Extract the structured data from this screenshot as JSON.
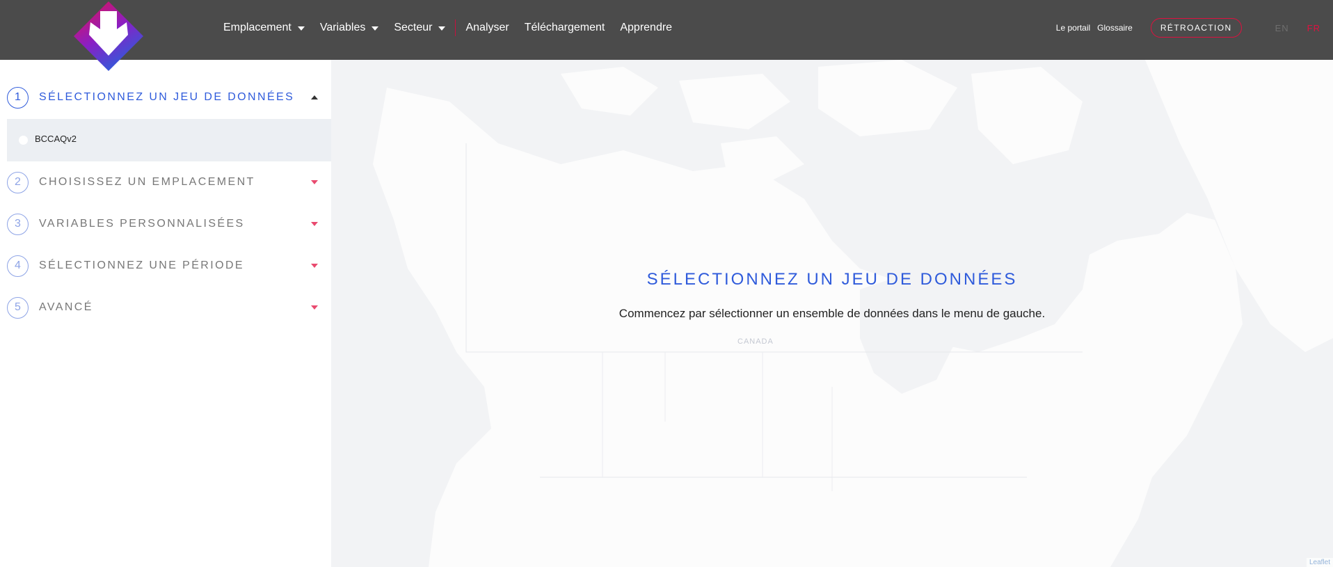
{
  "header": {
    "nav": [
      {
        "label": "Emplacement",
        "dropdown": true
      },
      {
        "label": "Variables",
        "dropdown": true
      },
      {
        "label": "Secteur",
        "dropdown": true
      },
      {
        "label": "Analyser",
        "dropdown": false
      },
      {
        "label": "Téléchargement",
        "dropdown": false
      },
      {
        "label": "Apprendre",
        "dropdown": false
      }
    ],
    "portal_label": "Le portail",
    "glossary_label": "Glossaire",
    "feedback_label": "RÉTROACTION",
    "lang_en": "EN",
    "lang_fr": "FR",
    "colors": {
      "header_bg": "#4b4b4b",
      "accent_red": "#e0103f",
      "accent_blue": "#2f5bdb"
    }
  },
  "sidebar": {
    "steps": [
      {
        "num": "1",
        "label": "SÉLECTIONNEZ UN JEU DE DONNÉES",
        "expanded": true
      },
      {
        "num": "2",
        "label": "CHOISISSEZ UN EMPLACEMENT",
        "expanded": false
      },
      {
        "num": "3",
        "label": "VARIABLES PERSONNALISÉES",
        "expanded": false
      },
      {
        "num": "4",
        "label": "SÉLECTIONNEZ UNE PÉRIODE",
        "expanded": false
      },
      {
        "num": "5",
        "label": "AVANCÉ",
        "expanded": false
      }
    ],
    "dataset_option": "BCCAQv2"
  },
  "map": {
    "title": "SÉLECTIONNEZ UN JEU DE DONNÉES",
    "subtitle": "Commencez par sélectionner un ensemble de données dans le menu de gauche.",
    "country_label": "CANADA",
    "attribution": "Leaflet"
  }
}
